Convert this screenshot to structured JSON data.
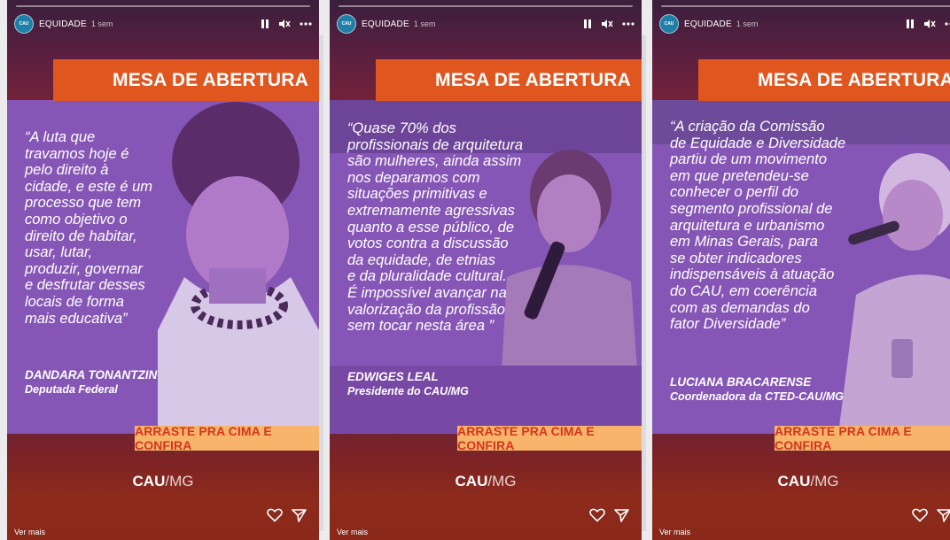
{
  "stories": [
    {
      "account": "EQUIDADE",
      "time": "1 sem",
      "avatar_text": "CAU",
      "banner": "MESA DE ABERTURA",
      "quote_lines": [
        "“A luta que",
        "travamos hoje é",
        "pelo direito à",
        "cidade, e este é um",
        "processo que tem",
        "como objetivo o",
        "direito de habitar,",
        "usar, lutar,",
        "produzir, governar",
        "e desfrutar desses",
        "locais de forma",
        "mais educativa”"
      ],
      "author_name": "DANDARA TONANTZIN",
      "author_role": "Deputada Federal",
      "cta": "ARRASTE PRA CIMA E CONFIRA",
      "logo_bold": "CAU",
      "logo_light": "/MG",
      "ver_mais": "Ver mais"
    },
    {
      "account": "EQUIDADE",
      "time": "1 sem",
      "avatar_text": "CAU",
      "banner": "MESA DE ABERTURA",
      "quote_lines": [
        "“Quase 70% dos",
        "profissionais de arquitetura",
        "são mulheres, ainda assim",
        "nos deparamos com",
        "situações primitivas e",
        "extremamente agressivas",
        "quanto a esse público, de",
        "votos contra a discussão",
        "da equidade, de etnias",
        "e da pluralidade cultural.",
        "É impossível avançar na",
        "valorização da profissão",
        "sem tocar nesta área ”"
      ],
      "author_name": "EDWIGES LEAL",
      "author_role": "Presidente do CAU/MG",
      "cta": "ARRASTE PRA CIMA E CONFIRA",
      "logo_bold": "CAU",
      "logo_light": "/MG",
      "ver_mais": "Ver mais"
    },
    {
      "account": "EQUIDADE",
      "time": "1 sem",
      "avatar_text": "CAU",
      "banner": "MESA DE ABERTURA",
      "quote_lines": [
        "“A criação da Comissão",
        "de Equidade e Diversidade",
        "partiu de um movimento",
        "em que pretendeu-se",
        "conhecer o perfil do",
        "segmento profissional de",
        "arquitetura e urbanismo",
        "em Minas Gerais, para",
        "se obter indicadores",
        "indispensáveis à atuação",
        "do CAU, em coerência",
        "com as demandas do",
        "fator Diversidade”"
      ],
      "author_name": "LUCIANA BRACARENSE",
      "author_role": "Coordenadora da CTED-CAU/MG",
      "cta": "ARRASTE PRA CIMA E CONFIRA",
      "logo_bold": "CAU",
      "logo_light": "/MG",
      "ver_mais": "Ver mais"
    }
  ],
  "icons": {
    "pause": "pause-icon",
    "mute": "mute-icon",
    "more": "more-icon",
    "like": "heart-icon",
    "share": "send-icon"
  },
  "colors": {
    "banner": "#e0561f",
    "cta_bg": "#f7b46a",
    "cta_text": "#d4351f",
    "photo_tint": "#8a5ab8",
    "story_bg": "#7c2a4a"
  }
}
